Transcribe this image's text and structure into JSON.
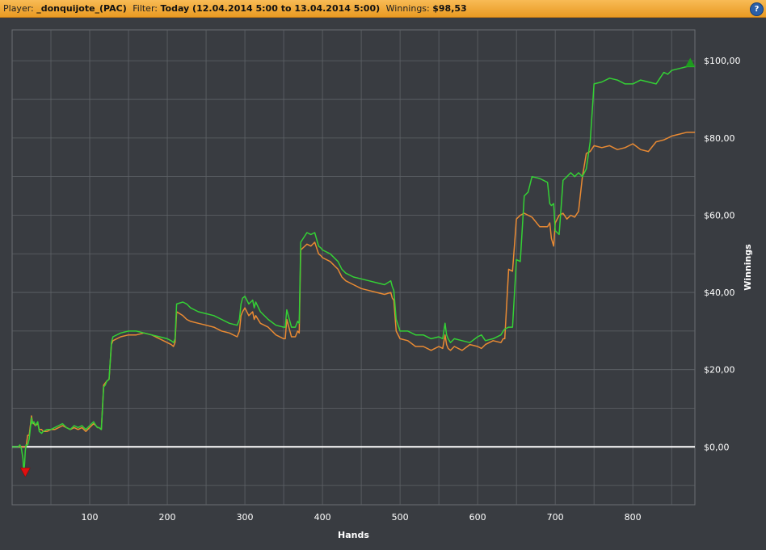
{
  "header": {
    "player_label": "Player:",
    "player_name": "_donquijote_(PAC)",
    "filter_label": "Filter:",
    "filter_value": "Today (12.04.2014 5:00 to 13.04.2014 5:00)",
    "winnings_label": "Winnings:",
    "winnings_value": "$98,53",
    "help_icon": "question-icon",
    "help_label": "?"
  },
  "colors": {
    "background": "#393c41",
    "grid": "#5f6368",
    "plot_border": "#6b6e73",
    "zero_line": "#ffffff",
    "series_green": "#34d035",
    "series_orange": "#e98a33",
    "max_marker": "#1e9a1e",
    "min_marker": "#e01010"
  },
  "chart_data": {
    "type": "line",
    "xlabel": "Hands",
    "ylabel": "Winnings",
    "xlim": [
      0,
      880
    ],
    "ylim": [
      -15,
      108
    ],
    "x_ticks": [
      100,
      200,
      300,
      400,
      500,
      600,
      700,
      800
    ],
    "y_ticks": [
      0,
      20,
      40,
      60,
      80,
      100
    ],
    "y_tick_labels": [
      "$0,00",
      "$20,00",
      "$40,00",
      "$60,00",
      "$80,00",
      "$100,00"
    ],
    "grid": true,
    "legend": "none",
    "max_marker": {
      "x": 874,
      "y": 99.5
    },
    "min_marker": {
      "x": 17,
      "y": -6.5
    },
    "series": [
      {
        "color_key": "series_green",
        "x": [
          0,
          8,
          10,
          12,
          14,
          15,
          16,
          17,
          18,
          20,
          22,
          25,
          26,
          28,
          30,
          33,
          35,
          38,
          40,
          45,
          50,
          55,
          60,
          65,
          70,
          75,
          80,
          85,
          90,
          95,
          100,
          105,
          108,
          110,
          112,
          115,
          118,
          120,
          122,
          125,
          128,
          130,
          140,
          150,
          160,
          170,
          180,
          190,
          200,
          205,
          208,
          210,
          212,
          220,
          225,
          230,
          240,
          250,
          260,
          270,
          280,
          290,
          293,
          295,
          297,
          300,
          305,
          310,
          312,
          314,
          320,
          330,
          340,
          350,
          352,
          354,
          360,
          365,
          368,
          370,
          372,
          380,
          385,
          390,
          395,
          398,
          400,
          410,
          420,
          425,
          430,
          440,
          450,
          460,
          470,
          480,
          488,
          490,
          492,
          495,
          500,
          510,
          520,
          530,
          540,
          550,
          555,
          558,
          560,
          562,
          565,
          570,
          580,
          590,
          600,
          605,
          610,
          620,
          630,
          633,
          635,
          640,
          645,
          650,
          655,
          660,
          665,
          670,
          680,
          690,
          693,
          695,
          698,
          700,
          705,
          710,
          715,
          720,
          725,
          730,
          735,
          740,
          745,
          750,
          760,
          770,
          780,
          790,
          800,
          810,
          820,
          830,
          840,
          845,
          850,
          860,
          870,
          880
        ],
        "y": [
          0,
          0,
          0.5,
          -0.5,
          -3,
          -6.5,
          -4.5,
          -1,
          0.5,
          0.5,
          2,
          7.5,
          6,
          6.5,
          5.5,
          6.5,
          4,
          3.5,
          4,
          4.5,
          4.5,
          5,
          5.5,
          6,
          5,
          4.5,
          5.5,
          5,
          5.5,
          4.5,
          5.5,
          6.5,
          5.5,
          5,
          5,
          4.5,
          15.5,
          16,
          17,
          17.5,
          27,
          28.5,
          29.5,
          30,
          30,
          29.5,
          29,
          28.5,
          28,
          27.5,
          27,
          28,
          37,
          37.5,
          37,
          36,
          35,
          34.5,
          34,
          33,
          32,
          31.5,
          33,
          37,
          38.5,
          39,
          37,
          38,
          36,
          37.5,
          35,
          33,
          31.5,
          31,
          31,
          35.5,
          31,
          31,
          32.5,
          32,
          53,
          55.5,
          55,
          55.5,
          52,
          51.5,
          51,
          50,
          48,
          46,
          45,
          44,
          43.5,
          43,
          42.5,
          42,
          43,
          41.5,
          40.5,
          33,
          30,
          30,
          29,
          29,
          28,
          28.5,
          28,
          32,
          29,
          28,
          27,
          28,
          27.5,
          27,
          28.5,
          29,
          27.5,
          28,
          29,
          30,
          30.5,
          31,
          31,
          48.5,
          48,
          65,
          66,
          70,
          69.5,
          68.5,
          63,
          62.5,
          63,
          56,
          55,
          69,
          70,
          71,
          70,
          71,
          70,
          72,
          79,
          94,
          94.5,
          95.5,
          95,
          94,
          94,
          95,
          94.5,
          94,
          97,
          96.5,
          97.5,
          98,
          98.5,
          98.5
        ]
      },
      {
        "color_key": "series_orange",
        "x": [
          0,
          15,
          18,
          20,
          22,
          25,
          26,
          28,
          30,
          33,
          35,
          38,
          40,
          45,
          50,
          55,
          60,
          65,
          70,
          75,
          80,
          85,
          90,
          95,
          100,
          105,
          108,
          110,
          112,
          115,
          118,
          120,
          122,
          125,
          128,
          130,
          140,
          150,
          160,
          170,
          180,
          190,
          200,
          205,
          208,
          210,
          212,
          220,
          225,
          230,
          240,
          250,
          260,
          270,
          280,
          290,
          293,
          295,
          297,
          300,
          305,
          310,
          312,
          314,
          320,
          330,
          340,
          350,
          352,
          354,
          360,
          365,
          368,
          370,
          372,
          380,
          385,
          390,
          395,
          398,
          400,
          410,
          420,
          425,
          430,
          440,
          450,
          460,
          470,
          480,
          488,
          490,
          492,
          495,
          500,
          510,
          520,
          530,
          540,
          550,
          555,
          558,
          560,
          562,
          565,
          570,
          580,
          590,
          600,
          605,
          610,
          620,
          630,
          633,
          635,
          640,
          645,
          650,
          655,
          660,
          665,
          670,
          680,
          690,
          693,
          695,
          698,
          700,
          705,
          710,
          715,
          720,
          725,
          730,
          735,
          740,
          745,
          750,
          760,
          770,
          780,
          790,
          800,
          810,
          820,
          830,
          840,
          845,
          850,
          860,
          870,
          880
        ],
        "y": [
          0,
          0,
          0,
          3,
          3,
          8,
          6.5,
          6,
          5.5,
          6,
          4.5,
          4.5,
          4,
          4,
          4.5,
          4.5,
          5,
          5.5,
          5,
          4.5,
          5,
          4.5,
          5,
          4,
          5,
          6,
          5.5,
          5,
          5,
          4.5,
          16,
          16.5,
          17,
          17.5,
          26.5,
          27.5,
          28.5,
          29,
          29,
          29.5,
          29,
          28,
          27,
          26.5,
          26,
          27,
          35,
          34,
          33,
          32.5,
          32,
          31.5,
          31,
          30,
          29.5,
          28.5,
          30,
          34,
          35,
          36,
          34,
          35,
          33,
          34,
          32,
          31,
          29,
          28,
          28,
          33,
          28.5,
          28.5,
          30,
          29.5,
          51,
          52.5,
          52,
          53,
          50,
          49.5,
          49,
          48,
          46,
          44,
          43,
          42,
          41,
          40.5,
          40,
          39.5,
          40,
          38.5,
          38,
          30,
          28,
          27.5,
          26,
          26,
          25,
          26,
          25.5,
          29,
          26.5,
          25.5,
          25,
          26,
          25,
          26.5,
          26,
          25.5,
          26.5,
          27.5,
          27,
          28,
          28,
          46,
          45.5,
          59,
          60,
          60.5,
          60,
          59.5,
          57,
          57,
          58,
          54,
          52,
          58,
          60,
          60.5,
          59,
          60,
          59.5,
          61,
          70,
          76,
          76.5,
          78,
          77.5,
          78,
          77,
          77.5,
          78.5,
          77,
          76.5,
          79,
          79.5,
          80,
          80.5,
          81,
          81.5,
          81.5
        ]
      }
    ]
  }
}
